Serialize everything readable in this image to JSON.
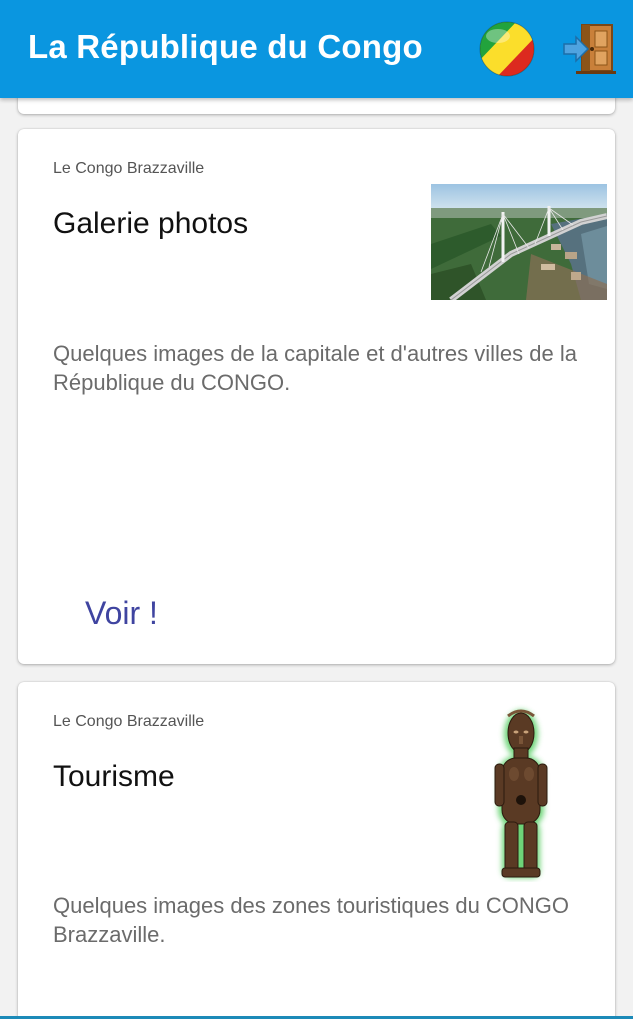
{
  "appbar": {
    "title": "La République du Congo",
    "flag_icon": "congo-flag-icon",
    "exit_icon": "exit-door-icon",
    "color": "#0a96e0"
  },
  "cards": [
    {
      "overline": "Le Congo Brazzaville",
      "title": "Galerie photos",
      "description": "Quelques images de la capitale et d'autres villes de la République du CONGO.",
      "action": "Voir !",
      "image": "brazzaville-bridge-photo"
    },
    {
      "overline": "Le Congo Brazzaville",
      "title": "Tourisme",
      "description": "Quelques images des zones touristiques du CONGO Brazzaville.",
      "image": "wooden-statue-photo"
    }
  ],
  "colors": {
    "accent": "#3f44a0"
  }
}
